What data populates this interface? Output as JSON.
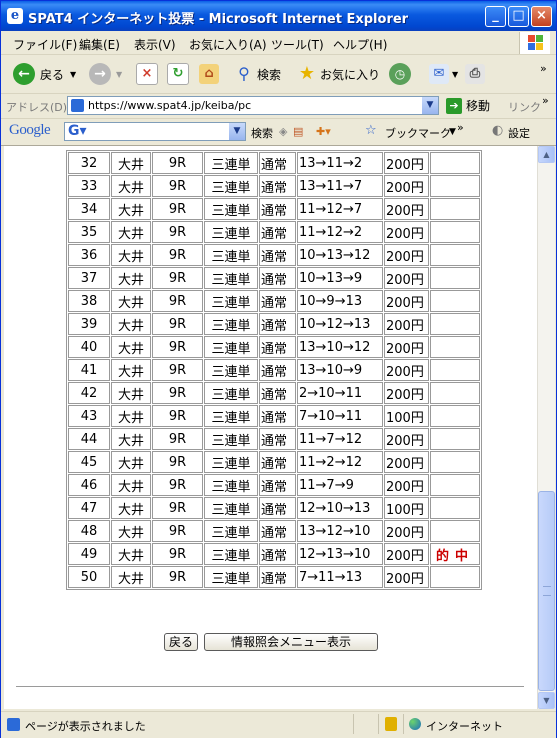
{
  "window": {
    "title": "SPAT4 インターネット投票 - Microsoft Internet Explorer",
    "min": "_",
    "max": "□",
    "close": "×"
  },
  "menu": [
    "ファイル(F)",
    "編集(E)",
    "表示(V)",
    "お気に入り(A)",
    "ツール(T)",
    "ヘルプ(H)"
  ],
  "toolbar": {
    "back": "戻る",
    "search": "検索",
    "favorites": "お気に入り"
  },
  "address": {
    "label": "アドレス(D)",
    "url": "https://www.spat4.jp/keiba/pc",
    "go": "移動",
    "links": "リンク"
  },
  "google": {
    "logo": "Google",
    "search": "検索",
    "bookmarks": "ブックマーク",
    "settings": "設定"
  },
  "bets": {
    "rows": [
      {
        "no": "32",
        "place": "大井",
        "race": "9R",
        "type": "三連単",
        "method": "通常",
        "combo": "13→11→2",
        "amount": "200円",
        "result": ""
      },
      {
        "no": "33",
        "place": "大井",
        "race": "9R",
        "type": "三連単",
        "method": "通常",
        "combo": "13→11→7",
        "amount": "200円",
        "result": ""
      },
      {
        "no": "34",
        "place": "大井",
        "race": "9R",
        "type": "三連単",
        "method": "通常",
        "combo": "11→12→7",
        "amount": "200円",
        "result": ""
      },
      {
        "no": "35",
        "place": "大井",
        "race": "9R",
        "type": "三連単",
        "method": "通常",
        "combo": "11→12→2",
        "amount": "200円",
        "result": ""
      },
      {
        "no": "36",
        "place": "大井",
        "race": "9R",
        "type": "三連単",
        "method": "通常",
        "combo": "10→13→12",
        "amount": "200円",
        "result": ""
      },
      {
        "no": "37",
        "place": "大井",
        "race": "9R",
        "type": "三連単",
        "method": "通常",
        "combo": "10→13→9",
        "amount": "200円",
        "result": ""
      },
      {
        "no": "38",
        "place": "大井",
        "race": "9R",
        "type": "三連単",
        "method": "通常",
        "combo": "10→9→13",
        "amount": "200円",
        "result": ""
      },
      {
        "no": "39",
        "place": "大井",
        "race": "9R",
        "type": "三連単",
        "method": "通常",
        "combo": "10→12→13",
        "amount": "200円",
        "result": ""
      },
      {
        "no": "40",
        "place": "大井",
        "race": "9R",
        "type": "三連単",
        "method": "通常",
        "combo": "13→10→12",
        "amount": "200円",
        "result": ""
      },
      {
        "no": "41",
        "place": "大井",
        "race": "9R",
        "type": "三連単",
        "method": "通常",
        "combo": "13→10→9",
        "amount": "200円",
        "result": ""
      },
      {
        "no": "42",
        "place": "大井",
        "race": "9R",
        "type": "三連単",
        "method": "通常",
        "combo": "2→10→11",
        "amount": "200円",
        "result": ""
      },
      {
        "no": "43",
        "place": "大井",
        "race": "9R",
        "type": "三連単",
        "method": "通常",
        "combo": "7→10→11",
        "amount": "100円",
        "result": ""
      },
      {
        "no": "44",
        "place": "大井",
        "race": "9R",
        "type": "三連単",
        "method": "通常",
        "combo": "11→7→12",
        "amount": "200円",
        "result": ""
      },
      {
        "no": "45",
        "place": "大井",
        "race": "9R",
        "type": "三連単",
        "method": "通常",
        "combo": "11→2→12",
        "amount": "200円",
        "result": ""
      },
      {
        "no": "46",
        "place": "大井",
        "race": "9R",
        "type": "三連単",
        "method": "通常",
        "combo": "11→7→9",
        "amount": "200円",
        "result": ""
      },
      {
        "no": "47",
        "place": "大井",
        "race": "9R",
        "type": "三連単",
        "method": "通常",
        "combo": "12→10→13",
        "amount": "100円",
        "result": ""
      },
      {
        "no": "48",
        "place": "大井",
        "race": "9R",
        "type": "三連単",
        "method": "通常",
        "combo": "13→12→10",
        "amount": "200円",
        "result": ""
      },
      {
        "no": "49",
        "place": "大井",
        "race": "9R",
        "type": "三連単",
        "method": "通常",
        "combo": "12→13→10",
        "amount": "200円",
        "result": "的中"
      },
      {
        "no": "50",
        "place": "大井",
        "race": "9R",
        "type": "三連単",
        "method": "通常",
        "combo": "7→11→13",
        "amount": "200円",
        "result": ""
      }
    ]
  },
  "buttons": {
    "back": "戻る",
    "menu": "情報照会メニュー表示"
  },
  "status": {
    "message": "ページが表示されました",
    "zone": "インターネット"
  },
  "colors": {
    "titlebar": "#0a5ae0",
    "hit": "#cc0000"
  }
}
